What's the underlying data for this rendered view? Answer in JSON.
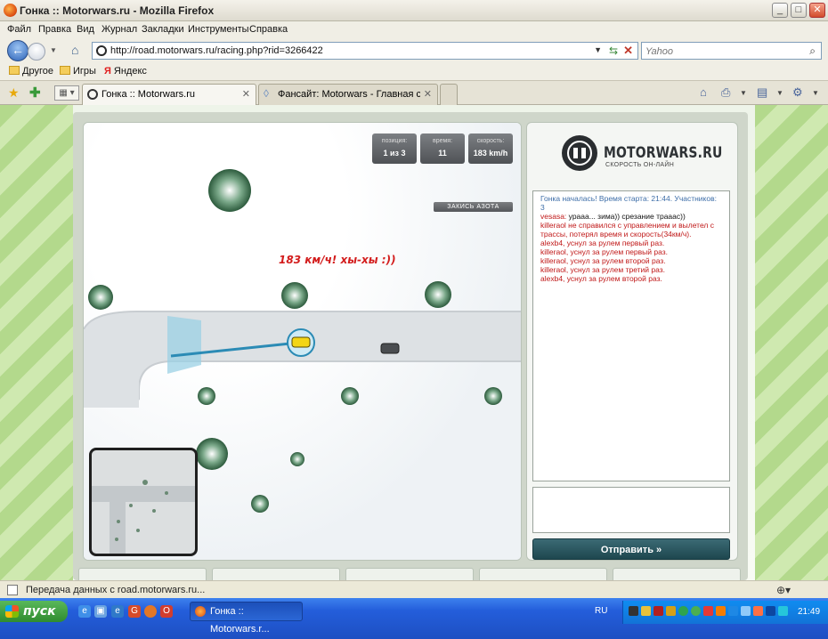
{
  "window": {
    "title": "Гонка :: Motorwars.ru - Mozilla Firefox",
    "controls": [
      "_",
      "□",
      "✕"
    ]
  },
  "menu": [
    "Файл",
    "Правка",
    "Вид",
    "Журнал",
    "Закладки",
    "Инструменты",
    "Справка"
  ],
  "nav": {
    "url": "http://road.motorwars.ru/racing.php?rid=3266422",
    "search_placeholder": "Yahoo"
  },
  "bookmarks": [
    "Другое",
    "Игры",
    "Яндекс"
  ],
  "tabs": [
    {
      "label": "Гонка :: Motorwars.ru",
      "active": true
    },
    {
      "label": "Фансайт: Motorwars - Главная стр...",
      "active": false
    }
  ],
  "game": {
    "hud": [
      {
        "label": "позиция:",
        "value": "1 из 3"
      },
      {
        "label": "время:",
        "value": "11"
      },
      {
        "label": "скорость:",
        "value": "183 km/h"
      }
    ],
    "nitro_label": "ЗАКИСЬ АЗОТА",
    "speed_message": "183 км/ч! хы-хы :))"
  },
  "side": {
    "logo": "MOTORWARS.RU",
    "logo_sub": "СКОРОСТЬ ОН-ЛАЙН",
    "chat": [
      {
        "type": "sys",
        "text": "Гонка началась! Время старта: 21:44. Участников: 3"
      },
      {
        "type": "user",
        "nick": "vesasa:",
        "text": " урааа... зима)) срезание трааас))"
      },
      {
        "type": "event",
        "text": "killeraol не справился с управлением и вылетел с трассы, потерял время и скорость(34км/ч)."
      },
      {
        "type": "event",
        "text": "alexb4, уснул за рулем первый раз."
      },
      {
        "type": "event",
        "text": "killeraol, уснул за рулем первый раз."
      },
      {
        "type": "event",
        "text": "killeraol, уснул за рулем второй раз."
      },
      {
        "type": "event",
        "text": "killeraol, уснул за рулем третий раз."
      },
      {
        "type": "event",
        "text": "alexb4, уснул за рулем второй раз."
      }
    ],
    "send_label": "Отправить »"
  },
  "status": {
    "text": "Передача данных с road.motorwars.ru..."
  },
  "taskbar": {
    "start_label": "пуск",
    "task_label": "Гонка :: Motorwars.r...",
    "lang": "RU",
    "clock": "21:49"
  },
  "colors": {
    "speed_message": "#d31d1d",
    "chat_event": "#c01818",
    "chat_system": "#3e6ea8",
    "send_button": "#1e474f"
  }
}
